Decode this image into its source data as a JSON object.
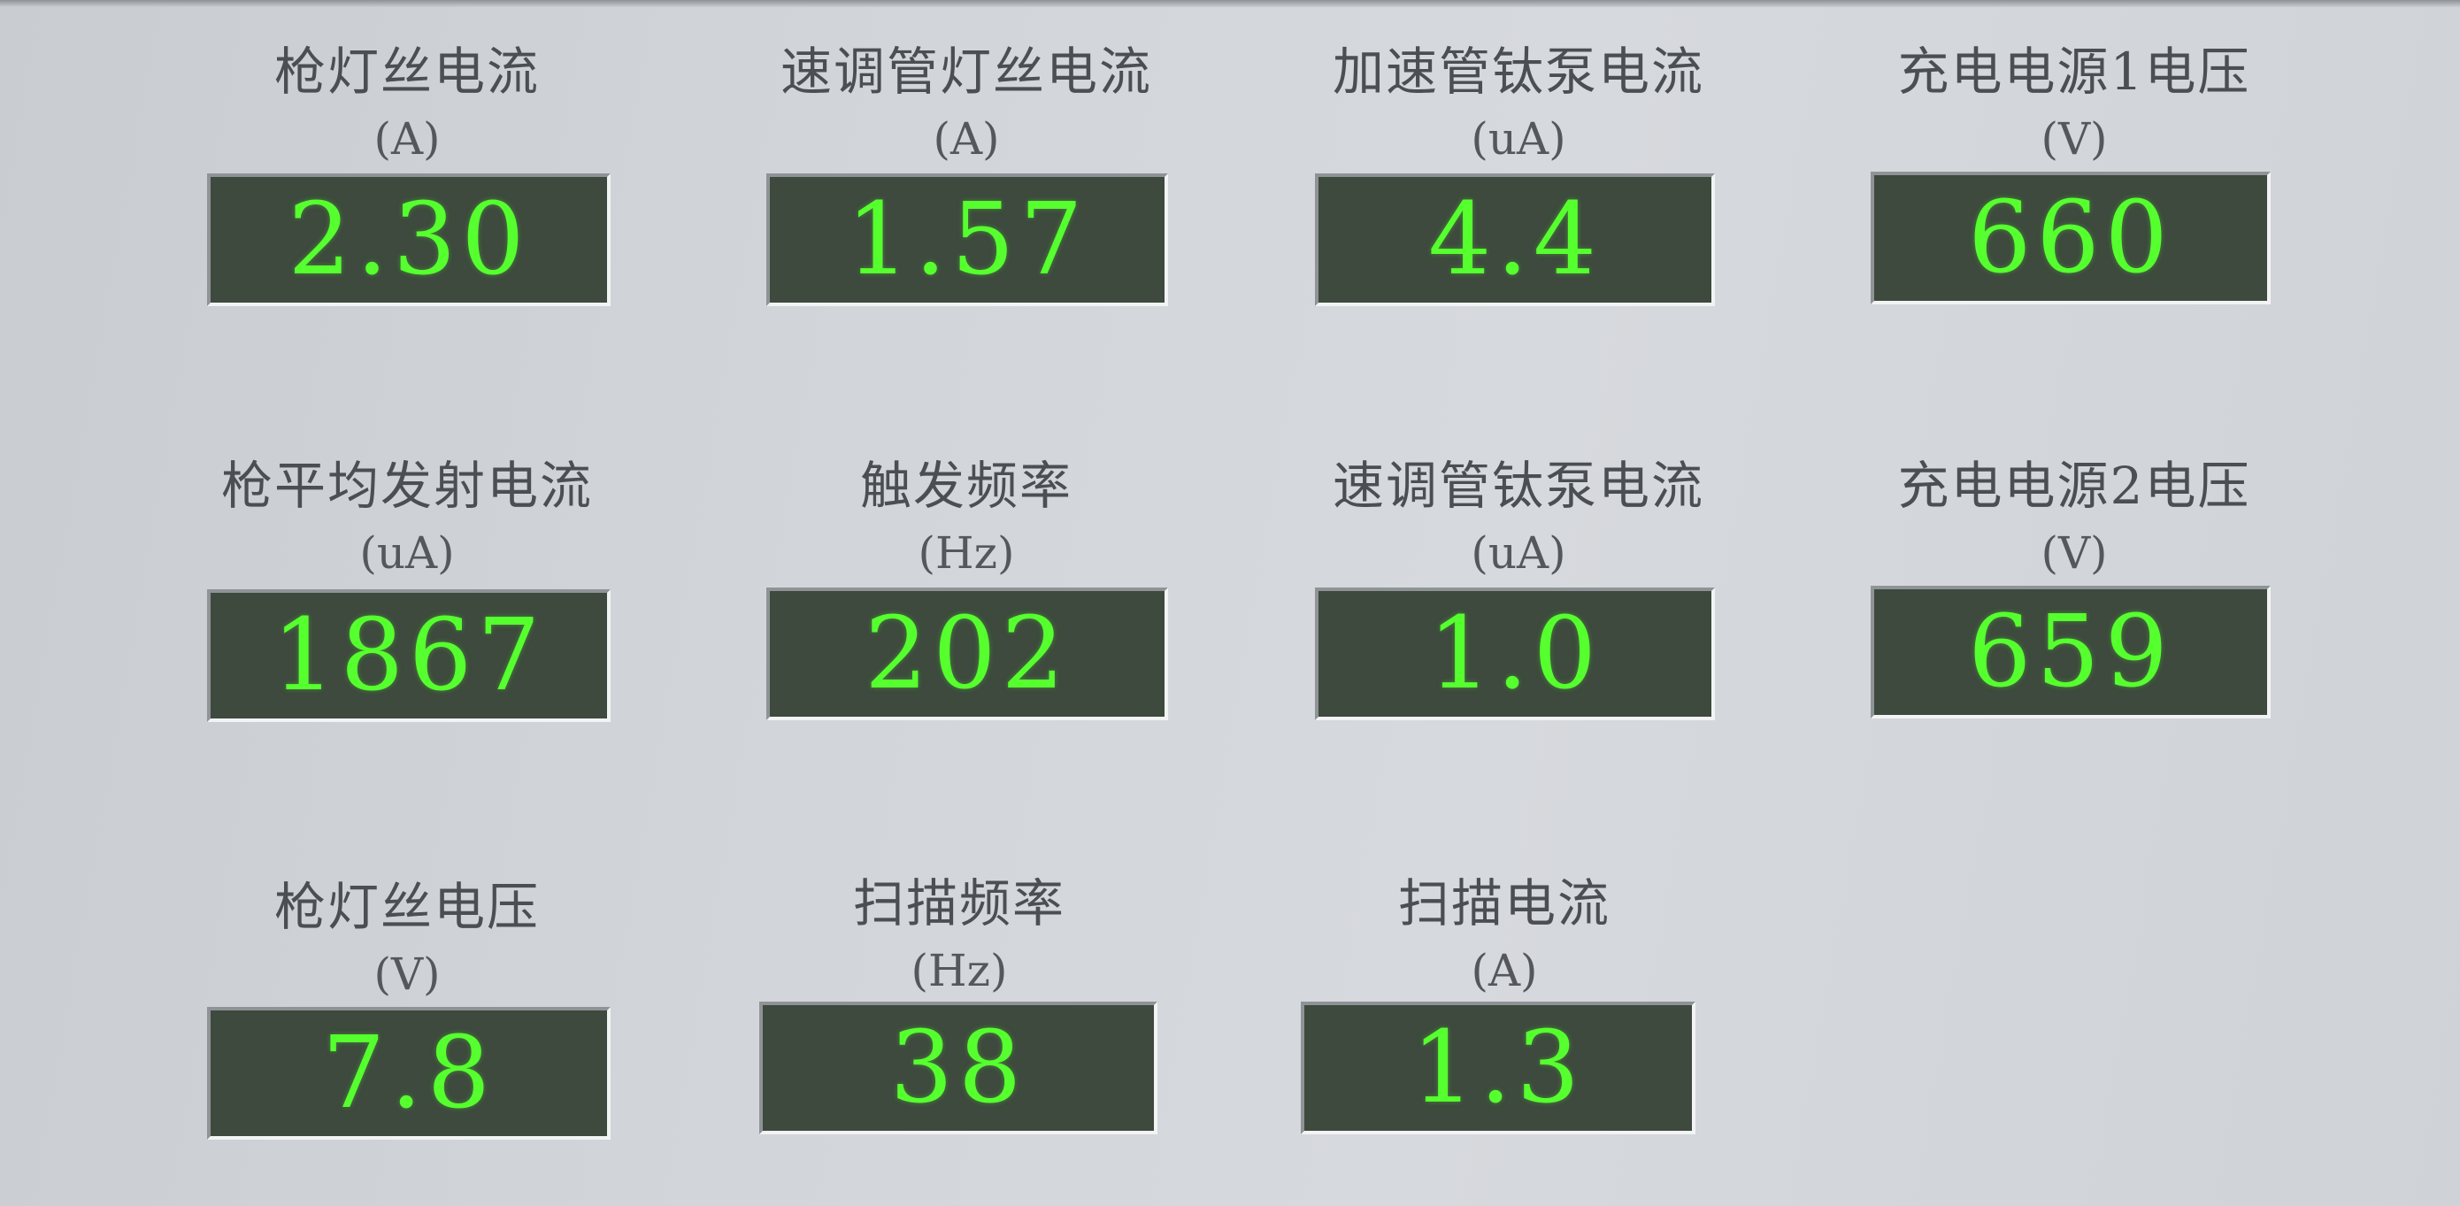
{
  "colors": {
    "panel_background": "#d2d6da",
    "display_background": "#3d4a3d",
    "display_text": "#56ff2e",
    "label_text": "#4b4e52"
  },
  "readouts": [
    {
      "label": "枪灯丝电流",
      "unit": "(A)",
      "value": "2.30"
    },
    {
      "label": "速调管灯丝电流",
      "unit": "(A)",
      "value": "1.57"
    },
    {
      "label": "加速管钛泵电流",
      "unit": "(uA)",
      "value": "4.4"
    },
    {
      "label": "充电电源1电压",
      "unit": "(V)",
      "value": "660"
    },
    {
      "label": "枪平均发射电流",
      "unit": "(uA)",
      "value": "1867"
    },
    {
      "label": "触发频率",
      "unit": "(Hz)",
      "value": "202"
    },
    {
      "label": "速调管钛泵电流",
      "unit": "(uA)",
      "value": "1.0"
    },
    {
      "label": "充电电源2电压",
      "unit": "(V)",
      "value": "659"
    },
    {
      "label": "枪灯丝电压",
      "unit": "(V)",
      "value": "7.8"
    },
    {
      "label": "扫描频率",
      "unit": "(Hz)",
      "value": "38"
    },
    {
      "label": "扫描电流",
      "unit": "(A)",
      "value": "1.3"
    }
  ]
}
